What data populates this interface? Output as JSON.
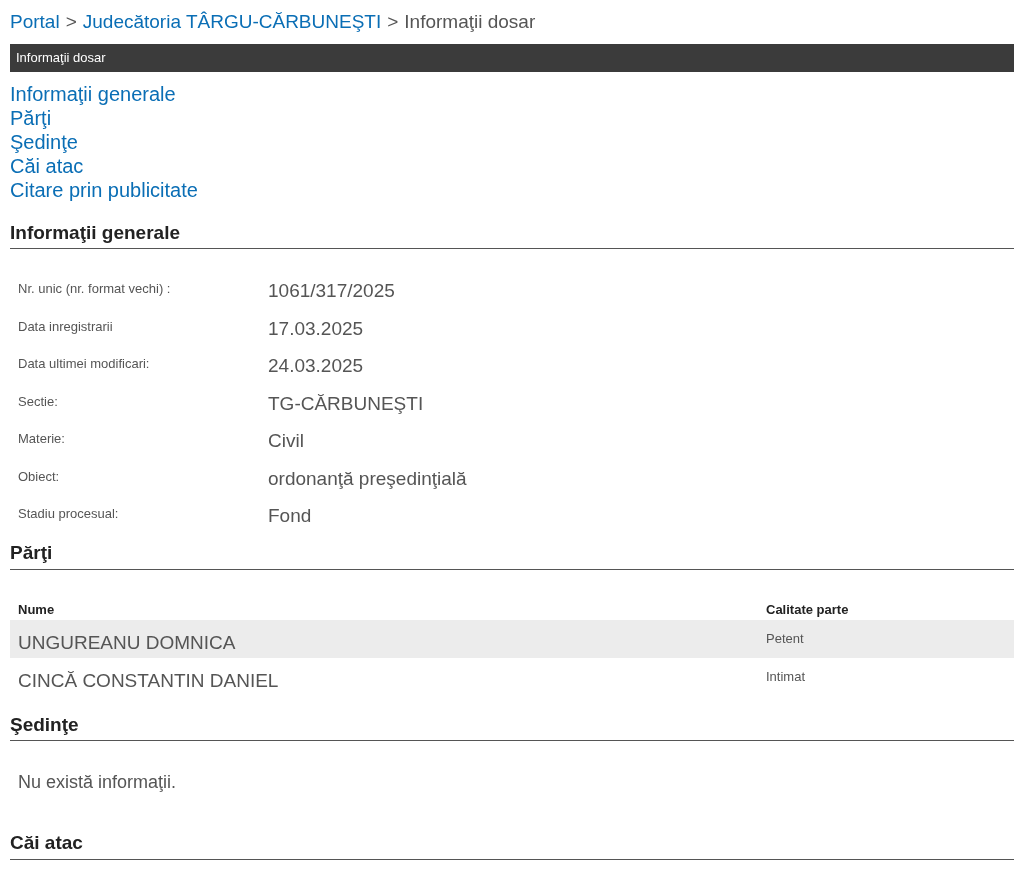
{
  "breadcrumb": [
    {
      "kind": "link",
      "label": "Portal"
    },
    {
      "kind": "separator",
      "label": ">"
    },
    {
      "kind": "link",
      "label": "Judecătoria TÂRGU-CĂRBUNEŞTI"
    },
    {
      "kind": "separator",
      "label": ">"
    },
    {
      "kind": "text",
      "label": "Informaţii dosar"
    }
  ],
  "title_bar": "Informaţii dosar",
  "nav_links": [
    "Informaţii generale",
    "Părţi",
    "Şedinţe",
    "Căi atac",
    "Citare prin publicitate"
  ],
  "general": {
    "heading": "Informaţii generale",
    "fields": [
      {
        "label": "Nr. unic (nr. format vechi) :",
        "value": "1061/317/2025"
      },
      {
        "label": "Data inregistrarii",
        "value": "17.03.2025"
      },
      {
        "label": "Data ultimei modificari:",
        "value": "24.03.2025"
      },
      {
        "label": "Sectie:",
        "value": "TG-CĂRBUNEŞTI"
      },
      {
        "label": "Materie:",
        "value": "Civil"
      },
      {
        "label": "Obiect:",
        "value": "ordonanţă preşedinţială"
      },
      {
        "label": "Stadiu procesual:",
        "value": "Fond"
      }
    ]
  },
  "parties": {
    "heading": "Părţi",
    "columns": [
      "Nume",
      "Calitate parte"
    ],
    "rows": [
      {
        "name": "UNGUREANU DOMNICA",
        "role": "Petent"
      },
      {
        "name": "CINCĂ CONSTANTIN DANIEL",
        "role": "Intimat"
      }
    ]
  },
  "hearings": {
    "heading": "Şedinţe",
    "message": "Nu există informaţii."
  },
  "appeals": {
    "heading": "Căi atac"
  }
}
